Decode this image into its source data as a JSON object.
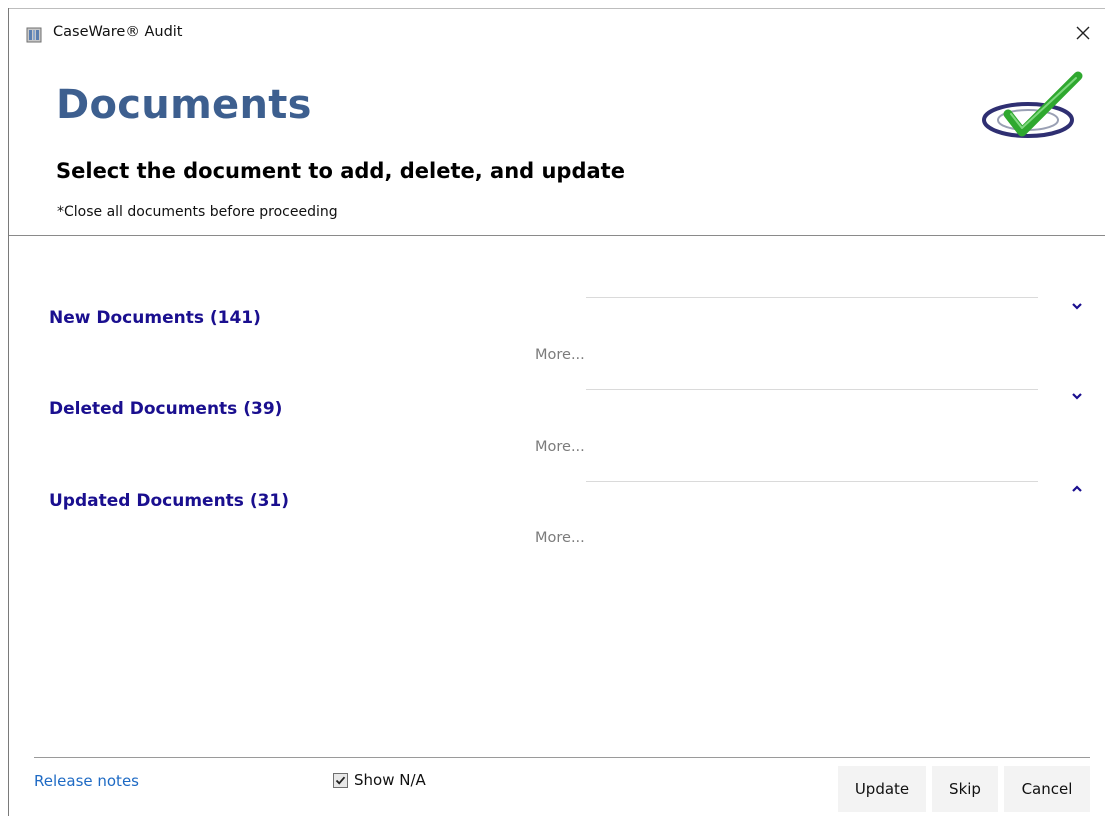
{
  "window": {
    "title": "CaseWare® Audit",
    "close_label": "close"
  },
  "header": {
    "title": "Documents",
    "subtitle": "Select the document to add, delete, and update",
    "note": "*Close all documents before proceeding"
  },
  "sections": [
    {
      "label": "New Documents (141)",
      "more": "More...",
      "expanded": false
    },
    {
      "label": "Deleted Documents (39)",
      "more": "More...",
      "expanded": false
    },
    {
      "label": "Updated Documents (31)",
      "more": "More...",
      "expanded": true
    }
  ],
  "footer": {
    "release_notes": "Release notes",
    "show_na_label": "Show N/A",
    "show_na_checked": true,
    "buttons": {
      "update": "Update",
      "skip": "Skip",
      "cancel": "Cancel"
    }
  },
  "colors": {
    "title": "#3d5f8f",
    "section_title": "#1a0f8f",
    "link": "#1e6ac4",
    "logo_check": "#2fa82f",
    "logo_ring": "#2f2f72"
  }
}
